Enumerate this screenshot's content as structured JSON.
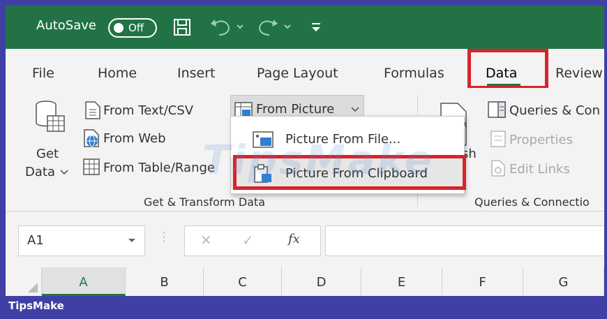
{
  "titlebar": {
    "autosave_label": "AutoSave",
    "toggle_state": "Off"
  },
  "menu": {
    "tabs": [
      "File",
      "Home",
      "Insert",
      "Page Layout",
      "Formulas",
      "Data",
      "Review"
    ],
    "active": "Data"
  },
  "ribbon": {
    "get_data_line1": "Get",
    "get_data_line2": "Data",
    "from_text_csv": "From Text/CSV",
    "from_web": "From Web",
    "from_table_range": "From Table/Range",
    "from_picture": "From Picture",
    "group_get_transform": "Get & Transform Data",
    "refresh_partial": "sh",
    "queries_connections": "Queries & Con",
    "properties": "Properties",
    "edit_links": "Edit Links",
    "group_queries": "Queries & Connectio"
  },
  "dropdown": {
    "items": [
      "Picture From File...",
      "Picture From Clipboard"
    ]
  },
  "formula_bar": {
    "name_box": "A1",
    "fx": "fx"
  },
  "columns": [
    "A",
    "B",
    "C",
    "D",
    "E",
    "F",
    "G"
  ],
  "footer": {
    "brand": "TipsMake"
  },
  "watermark": "TipsMake",
  "colors": {
    "excel_green": "#217346",
    "highlight_red": "#d8232a",
    "footer_blue": "#3f3fa6"
  }
}
